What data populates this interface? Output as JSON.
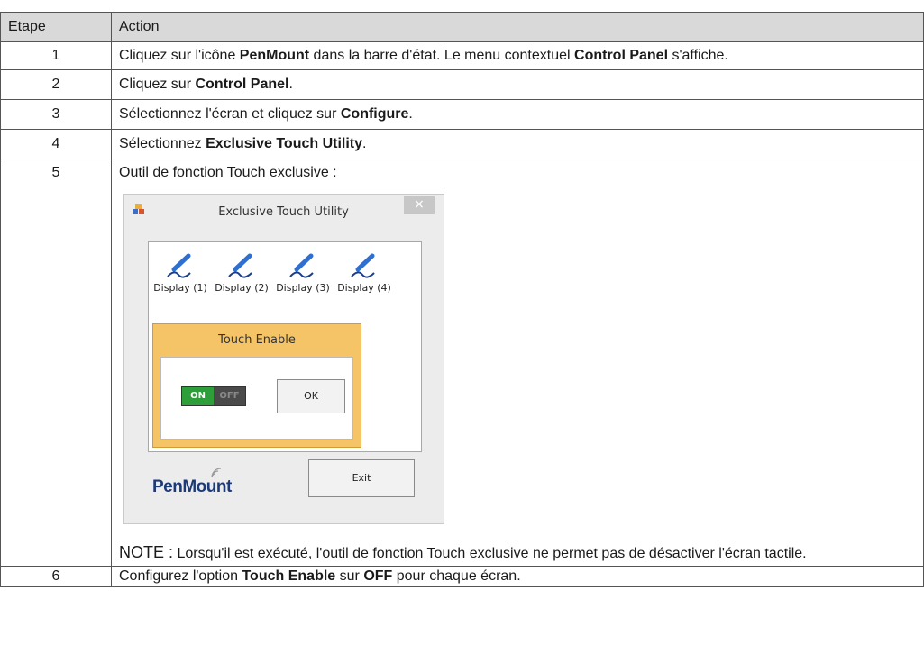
{
  "table": {
    "headers": {
      "step": "Etape",
      "action": "Action"
    },
    "rows": [
      {
        "step": "1",
        "parts": [
          "Cliquez sur l'icône ",
          "PenMount",
          " dans la barre d'état. Le menu contextuel ",
          "Control Panel",
          " s'affiche."
        ]
      },
      {
        "step": "2",
        "parts": [
          "Cliquez sur ",
          "Control Panel",
          "."
        ]
      },
      {
        "step": "3",
        "parts": [
          "Sélectionnez l'écran et cliquez sur ",
          "Configure",
          "."
        ]
      },
      {
        "step": "4",
        "parts": [
          "Sélectionnez ",
          "Exclusive Touch Utility",
          "."
        ]
      },
      {
        "step": "5",
        "parts": [
          "Outil de fonction Touch exclusive :"
        ]
      },
      {
        "step": "6",
        "parts": [
          "Configurez l'option ",
          "Touch Enable",
          " sur ",
          "OFF",
          " pour chaque écran."
        ]
      }
    ]
  },
  "dialog": {
    "title": "Exclusive Touch Utility",
    "close": "×",
    "displays": [
      "Display (1)",
      "Display (2)",
      "Display (3)",
      "Display (4)"
    ],
    "touch_enable": {
      "title": "Touch Enable",
      "toggle_on": "ON",
      "toggle_off": "OFF",
      "ok_label": "OK"
    },
    "logo": "PenMount",
    "exit_label": "Exit"
  },
  "note": {
    "label": "NOTE :",
    "text": " Lorsqu'il est exécuté, l'outil de fonction Touch exclusive ne permet pas de désactiver l'écran tactile."
  }
}
